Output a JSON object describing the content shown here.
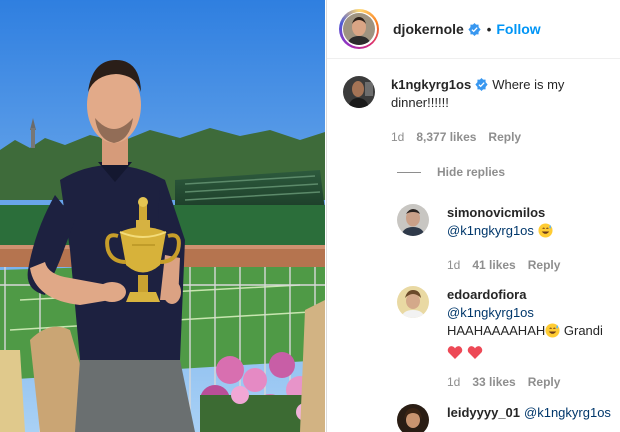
{
  "post": {
    "author": "djokernole",
    "follow_label": "Follow",
    "dot": "•"
  },
  "comments": [
    {
      "user": "k1ngkyrg1os",
      "verified": true,
      "text": "Where is my dinner!!!!!!",
      "time": "1d",
      "likes": "8,377 likes",
      "reply_label": "Reply"
    }
  ],
  "hide_replies_label": "Hide replies",
  "replies": [
    {
      "user": "simonovicmilos",
      "mention": "@k1ngkyrg1os",
      "emoji": "grinning-sweat-emoji",
      "time": "1d",
      "likes": "41 likes",
      "reply_label": "Reply"
    },
    {
      "user": "edoardofiora",
      "mention": "@k1ngkyrg1os",
      "text": "HAAHAAAAHAH",
      "text_after": "Grandi",
      "emoji": "grinning-sweat-emoji",
      "hearts": 2,
      "time": "1d",
      "likes": "33 likes",
      "reply_label": "Reply"
    },
    {
      "user": "leidyyyy_01",
      "mention": "@k1ngkyrg1os"
    }
  ],
  "colors": {
    "link": "#0095f6",
    "mention": "#00376b",
    "muted": "#8e8e8e",
    "heart": "#ed4956",
    "verified": "#3897f0"
  }
}
